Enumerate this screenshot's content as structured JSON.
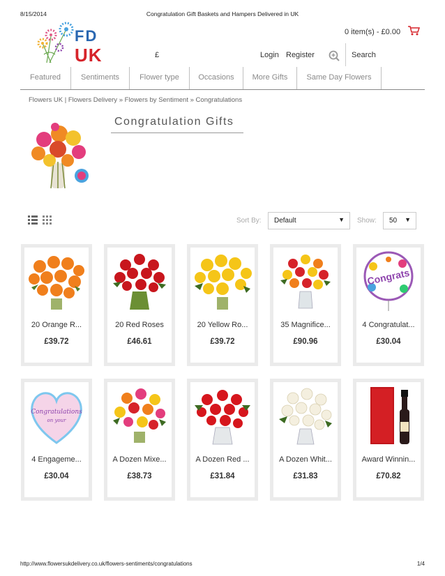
{
  "print": {
    "date": "8/15/2014",
    "title": "Congratulation Gift Baskets and Hampers Delivered in UK",
    "url": "http://www.flowersukdelivery.co.uk/flowers-sentiments/congratulations",
    "page": "1/4"
  },
  "logo": {
    "line1": "FD",
    "line2": "UK"
  },
  "header": {
    "cart": "0 item(s) - £0.00",
    "currency": "£",
    "login": "Login",
    "register": "Register",
    "search": "Search"
  },
  "nav": [
    "Featured",
    "Sentiments",
    "Flower type",
    "Occasions",
    "More Gifts",
    "Same Day Flowers"
  ],
  "breadcrumb": [
    "Flowers UK | Flowers Delivery",
    "Flowers by Sentiment",
    "Congratulations"
  ],
  "breadcrumb_sep": "»",
  "page_title": "Congratulation Gifts",
  "toolbar": {
    "sort_label": "Sort By:",
    "sort_value": "Default",
    "show_label": "Show:",
    "show_value": "50"
  },
  "products": [
    {
      "name": "20 Orange R...",
      "price": "£39.72"
    },
    {
      "name": "20 Red Roses",
      "price": "£46.61"
    },
    {
      "name": "20 Yellow Ro...",
      "price": "£39.72"
    },
    {
      "name": "35 Magnifice...",
      "price": "£90.96"
    },
    {
      "name": "4 Congratulat...",
      "price": "£30.04"
    },
    {
      "name": "4 Engageme...",
      "price": "£30.04"
    },
    {
      "name": "A Dozen Mixe...",
      "price": "£38.73"
    },
    {
      "name": "A Dozen Red ...",
      "price": "£31.84"
    },
    {
      "name": "A Dozen Whit...",
      "price": "£31.83"
    },
    {
      "name": "Award Winnin...",
      "price": "£70.82"
    }
  ],
  "colors": {
    "brand_blue": "#2a67b1",
    "brand_red": "#d6232a",
    "nav_text": "#8a8a8a",
    "card_border": "#ebebeb"
  }
}
